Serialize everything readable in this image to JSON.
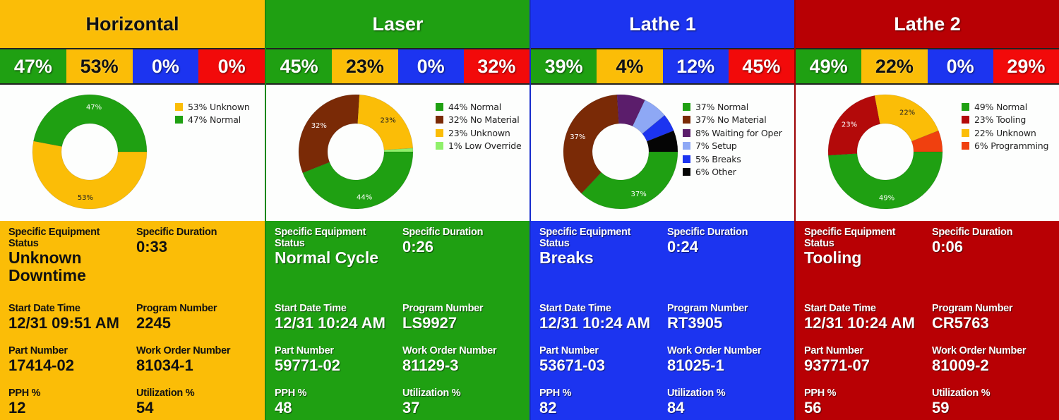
{
  "field_labels": {
    "status": "Specific Equipment Status",
    "duration": "Specific Duration",
    "start": "Start Date Time",
    "program": "Program Number",
    "part": "Part Number",
    "work_order": "Work Order Number",
    "pph": "PPH %",
    "utilization": "Utilization %"
  },
  "status_colors": {
    "normal": "#1fa012",
    "unknown": "#fbbd07",
    "blue": "#1c34f0",
    "red": "#f20a0a"
  },
  "panels": [
    {
      "name": "Horizontal",
      "theme_color": "#fbbd07",
      "text_theme": "dark",
      "summary": [
        {
          "value": "47%",
          "color": "#1fa012",
          "text": "light"
        },
        {
          "value": "53%",
          "color": "#fbbd07",
          "text": "dark"
        },
        {
          "value": "0%",
          "color": "#1c34f0",
          "text": "light"
        },
        {
          "value": "0%",
          "color": "#f20a0a",
          "text": "light"
        }
      ],
      "details": {
        "status": "Unknown Downtime",
        "duration": "0:33",
        "start": "12/31 09:51 AM",
        "program": "2245",
        "part": "17414-02",
        "work_order": "81034-1",
        "pph": "12",
        "utilization": "54"
      }
    },
    {
      "name": "Laser",
      "theme_color": "#1fa012",
      "text_theme": "light",
      "summary": [
        {
          "value": "45%",
          "color": "#1fa012",
          "text": "light"
        },
        {
          "value": "23%",
          "color": "#fbbd07",
          "text": "dark"
        },
        {
          "value": "0%",
          "color": "#1c34f0",
          "text": "light"
        },
        {
          "value": "32%",
          "color": "#f20a0a",
          "text": "light"
        }
      ],
      "details": {
        "status": "Normal Cycle",
        "duration": "0:26",
        "start": "12/31 10:24 AM",
        "program": "LS9927",
        "part": "59771-02",
        "work_order": "81129-3",
        "pph": "48",
        "utilization": "37"
      }
    },
    {
      "name": "Lathe 1",
      "theme_color": "#1c34f0",
      "text_theme": "light",
      "summary": [
        {
          "value": "39%",
          "color": "#1fa012",
          "text": "light"
        },
        {
          "value": "4%",
          "color": "#fbbd07",
          "text": "dark"
        },
        {
          "value": "12%",
          "color": "#1c34f0",
          "text": "light"
        },
        {
          "value": "45%",
          "color": "#f20a0a",
          "text": "light"
        }
      ],
      "details": {
        "status": "Breaks",
        "duration": "0:24",
        "start": "12/31 10:24 AM",
        "program": "RT3905",
        "part": "53671-03",
        "work_order": "81025-1",
        "pph": "82",
        "utilization": "84"
      }
    },
    {
      "name": "Lathe 2",
      "theme_color": "#b80004",
      "text_theme": "light",
      "summary": [
        {
          "value": "49%",
          "color": "#1fa012",
          "text": "light"
        },
        {
          "value": "22%",
          "color": "#fbbd07",
          "text": "dark"
        },
        {
          "value": "0%",
          "color": "#1c34f0",
          "text": "light"
        },
        {
          "value": "29%",
          "color": "#f20a0a",
          "text": "light"
        }
      ],
      "details": {
        "status": "Tooling",
        "duration": "0:06",
        "start": "12/31 10:24 AM",
        "program": "CR5763",
        "part": "93771-07",
        "work_order": "81009-2",
        "pph": "56",
        "utilization": "59"
      }
    }
  ],
  "chart_data": [
    {
      "type": "pie",
      "variant": "donut",
      "title": "Horizontal",
      "start_angle": "3 o'clock, clockwise",
      "legend_position": "top-right",
      "slices": [
        {
          "label": "Unknown",
          "value": 53,
          "legend": "53% Unknown",
          "color": "#fbbd07",
          "data_label": "53%",
          "label_color": "#222222"
        },
        {
          "label": "Normal",
          "value": 47,
          "legend": "47% Normal",
          "color": "#1fa012",
          "data_label": "47%",
          "label_color": "#ffffff"
        }
      ]
    },
    {
      "type": "pie",
      "variant": "donut",
      "title": "Laser",
      "start_angle": "3 o'clock, clockwise",
      "legend_position": "top-right",
      "slices": [
        {
          "label": "Normal",
          "value": 44,
          "legend": "44% Normal",
          "color": "#1fa012",
          "data_label": "44%",
          "label_color": "#ffffff"
        },
        {
          "label": "No Material",
          "value": 32,
          "legend": "32% No Material",
          "color": "#7a2a06",
          "data_label": "32%",
          "label_color": "#ffffff"
        },
        {
          "label": "Unknown",
          "value": 23,
          "legend": "23% Unknown",
          "color": "#fbbd07",
          "data_label": "23%",
          "label_color": "#222222"
        },
        {
          "label": "Low Override",
          "value": 1,
          "legend": "1% Low Override",
          "color": "#8ff06a",
          "data_label": "",
          "label_color": "#222222"
        }
      ]
    },
    {
      "type": "pie",
      "variant": "donut",
      "title": "Lathe 1",
      "start_angle": "3 o'clock, clockwise",
      "legend_position": "top-right",
      "slices": [
        {
          "label": "Normal",
          "value": 37,
          "legend": "37% Normal",
          "color": "#1fa012",
          "data_label": "37%",
          "label_color": "#ffffff"
        },
        {
          "label": "No Material",
          "value": 37,
          "legend": "37% No Material",
          "color": "#7a2a06",
          "data_label": "37%",
          "label_color": "#ffffff"
        },
        {
          "label": "Waiting for Oper",
          "value": 8,
          "legend": "8% Waiting for Oper",
          "color": "#5b1d6b",
          "data_label": "",
          "label_color": "#ffffff"
        },
        {
          "label": "Setup",
          "value": 7,
          "legend": "7% Setup",
          "color": "#8ea8f5",
          "data_label": "",
          "label_color": "#222222"
        },
        {
          "label": "Breaks",
          "value": 5,
          "legend": "5% Breaks",
          "color": "#1c34f0",
          "data_label": "",
          "label_color": "#ffffff"
        },
        {
          "label": "Other",
          "value": 6,
          "legend": "6% Other",
          "color": "#050505",
          "data_label": "",
          "label_color": "#ffffff"
        }
      ]
    },
    {
      "type": "pie",
      "variant": "donut",
      "title": "Lathe 2",
      "start_angle": "3 o'clock, clockwise",
      "legend_position": "top-right",
      "slices": [
        {
          "label": "Normal",
          "value": 49,
          "legend": "49% Normal",
          "color": "#1fa012",
          "data_label": "49%",
          "label_color": "#ffffff"
        },
        {
          "label": "Tooling",
          "value": 23,
          "legend": "23% Tooling",
          "color": "#b30a0a",
          "data_label": "23%",
          "label_color": "#ffffff"
        },
        {
          "label": "Unknown",
          "value": 22,
          "legend": "22% Unknown",
          "color": "#fbbd07",
          "data_label": "22%",
          "label_color": "#222222"
        },
        {
          "label": "Programming",
          "value": 6,
          "legend": "6% Programming",
          "color": "#f0400f",
          "data_label": "",
          "label_color": "#ffffff"
        }
      ]
    }
  ]
}
